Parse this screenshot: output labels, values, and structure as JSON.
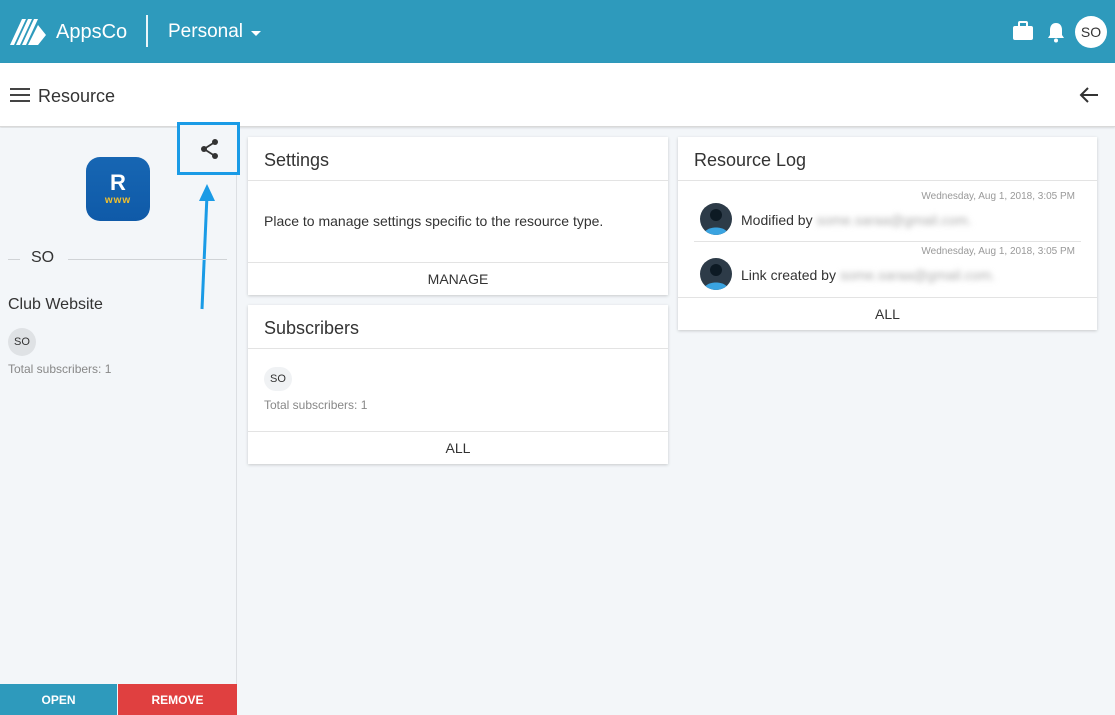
{
  "header": {
    "brand": "AppsCo",
    "org": "Personal",
    "user_initials": "SO",
    "icons": [
      "briefcase-icon",
      "bell-icon"
    ],
    "accent": "#2e9abc"
  },
  "subheader": {
    "title": "Resource"
  },
  "sidebar": {
    "logo_letter": "R",
    "logo_sub": "www",
    "owner": "SO",
    "resource_name": "Club Website",
    "subscriber_initials": "SO",
    "total_subscribers": "Total subscribers: 1",
    "open_label": "OPEN",
    "remove_label": "REMOVE"
  },
  "settings": {
    "title": "Settings",
    "description": "Place to manage settings specific to the resource type.",
    "action": "MANAGE"
  },
  "subscribers": {
    "title": "Subscribers",
    "initials": "SO",
    "total": "Total subscribers: 1",
    "action": "ALL"
  },
  "log": {
    "title": "Resource Log",
    "entries": [
      {
        "time": "Wednesday, Aug 1, 2018, 3:05 PM",
        "text": "Modified by",
        "email": "some.saraa@gmail.com."
      },
      {
        "time": "Wednesday, Aug 1, 2018, 3:05 PM",
        "text": "Link created by",
        "email": "some.saraa@gmail.com."
      }
    ],
    "action": "ALL"
  }
}
